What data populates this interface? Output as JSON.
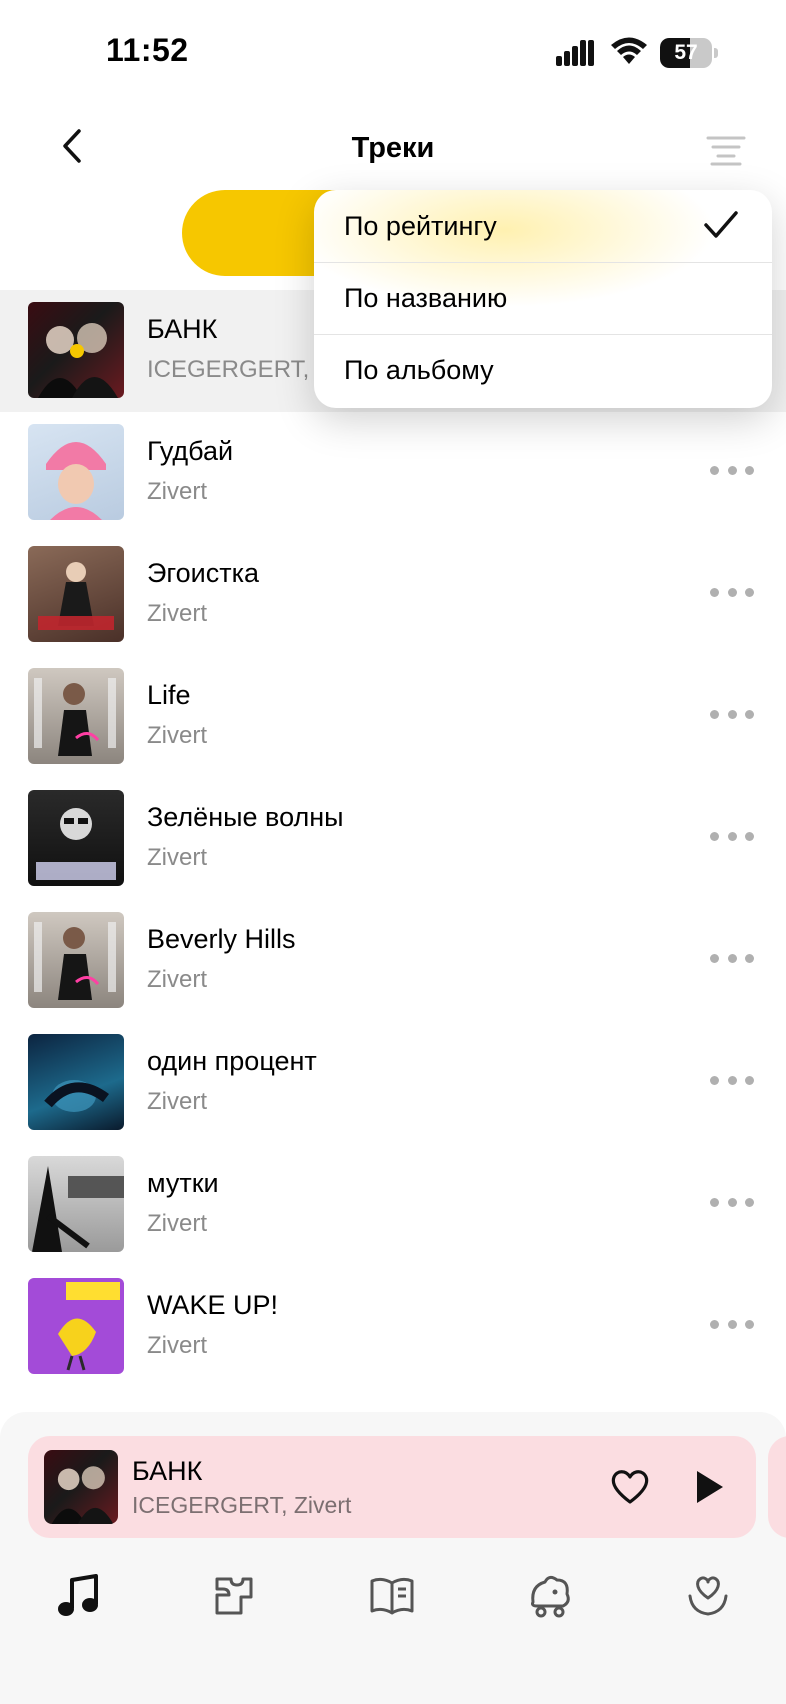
{
  "status_bar": {
    "time": "11:52",
    "battery_level": "57",
    "battery_percent": 57,
    "icons": [
      "cellular-signal-icon",
      "wifi-icon",
      "battery-icon"
    ]
  },
  "header": {
    "title": "Треки",
    "back_icon": "chevron-left-icon",
    "sort_icon": "sort-lines-icon"
  },
  "sort_menu": {
    "options": [
      {
        "label": "По рейтингу",
        "selected": true
      },
      {
        "label": "По названию",
        "selected": false
      },
      {
        "label": "По альбому",
        "selected": false
      }
    ],
    "check_icon": "checkmark-icon"
  },
  "tracks": [
    {
      "title": "БАНК",
      "artist": "ICEGERGERT, Zivert",
      "playing": true
    },
    {
      "title": "Гудбай",
      "artist": "Zivert"
    },
    {
      "title": "Эгоистка",
      "artist": "Zivert"
    },
    {
      "title": "Life",
      "artist": "Zivert"
    },
    {
      "title": "Зелёные волны",
      "artist": "Zivert"
    },
    {
      "title": "Beverly Hills",
      "artist": "Zivert"
    },
    {
      "title": "один процент",
      "artist": "Zivert"
    },
    {
      "title": "мутки",
      "artist": "Zivert"
    },
    {
      "title": "WAKE UP!",
      "artist": "Zivert"
    }
  ],
  "mini_player": {
    "title": "БАНК",
    "artist": "ICEGERGERT, Zivert",
    "like_icon": "heart-icon",
    "play_icon": "play-icon"
  },
  "tab_bar": {
    "tabs": [
      "music-note-icon",
      "map-icon",
      "book-icon",
      "kids-icon",
      "heart-hand-icon"
    ],
    "active_index": 0
  },
  "colors": {
    "accent_yellow": "#f6c700",
    "mini_player_bg": "#fbdde1",
    "secondary_text": "#8a8a8a",
    "divider": "#e4e4e4"
  }
}
